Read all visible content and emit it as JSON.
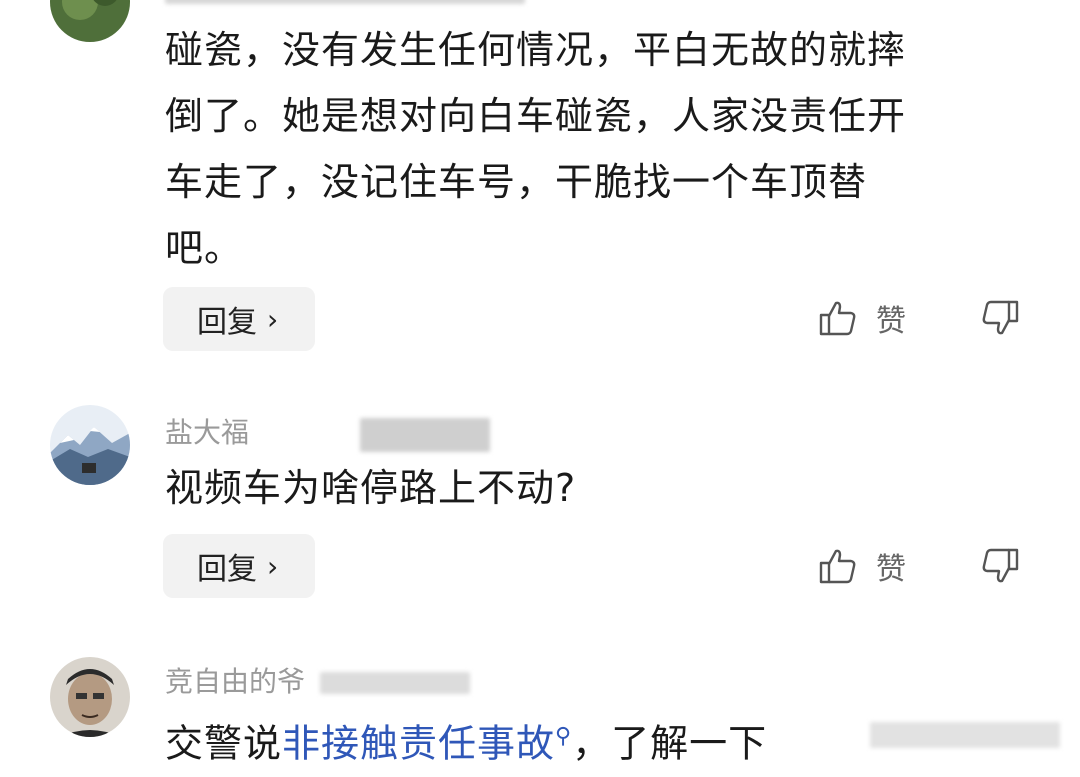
{
  "comments": [
    {
      "username": "",
      "text_lines": [
        "碰瓷，没有发生任何情况，平白无故的就摔",
        "倒了。她是想对向白车碰瓷，人家没责任开",
        "车走了，没记住车号，干脆找一个车顶替",
        "吧。"
      ],
      "reply_label": "回复",
      "like_label": "赞"
    },
    {
      "username": "盐大福",
      "text": "视频车为啥停路上不动?",
      "reply_label": "回复",
      "like_label": "赞"
    },
    {
      "username": "竞自由的爷",
      "text_before": "交警说",
      "link_text": "非接触责任事故",
      "text_after": "，了解一下"
    }
  ],
  "icons": {
    "like": "thumbs-up-icon",
    "dislike": "thumbs-down-icon",
    "chevron": "chevron-right-icon",
    "search": "search-icon"
  },
  "colors": {
    "link": "#2f57b8",
    "username": "#9a9a9a",
    "reply_bg": "#f2f2f2"
  }
}
